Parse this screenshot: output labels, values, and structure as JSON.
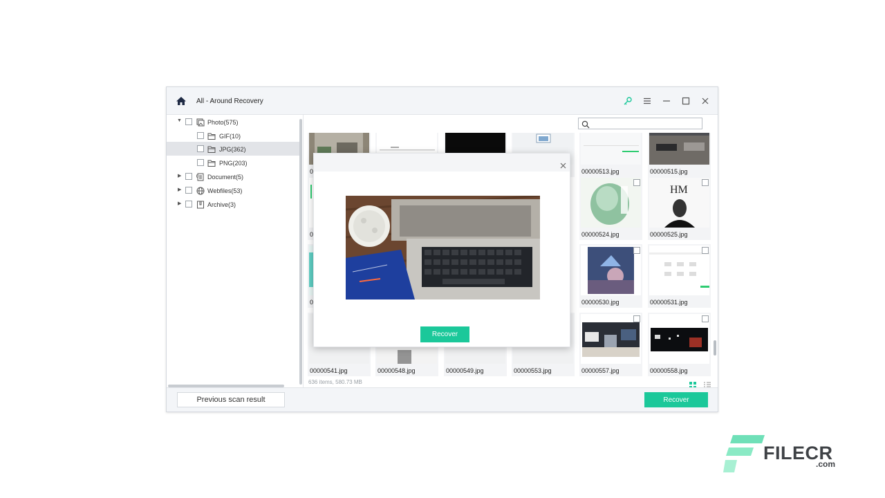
{
  "app": {
    "title": "All - Around Recovery",
    "accent_color": "#1bc89a"
  },
  "titlebar_icons": [
    "home-icon",
    "key-icon",
    "menu-icon",
    "minimize-icon",
    "maximize-icon",
    "close-icon"
  ],
  "sidebar": {
    "items": [
      {
        "label": "Photo(575)",
        "icon": "photo-icon",
        "expanded": true,
        "level": 0
      },
      {
        "label": "GIF(10)",
        "icon": "folder-icon",
        "level": 1
      },
      {
        "label": "JPG(362)",
        "icon": "folder-icon",
        "level": 1,
        "selected": true
      },
      {
        "label": "PNG(203)",
        "icon": "folder-icon",
        "level": 1
      },
      {
        "label": "Document(5)",
        "icon": "document-icon",
        "expanded": false,
        "level": 0
      },
      {
        "label": "Webfiles(53)",
        "icon": "globe-icon",
        "expanded": false,
        "level": 0
      },
      {
        "label": "Archive(3)",
        "icon": "archive-icon",
        "expanded": false,
        "level": 0
      }
    ]
  },
  "search": {
    "placeholder": ""
  },
  "grid": {
    "files": [
      "00000513.jpg",
      "00000515.jpg",
      "00000524.jpg",
      "00000525.jpg",
      "00000530.jpg",
      "00000531.jpg",
      "00000541.jpg",
      "00000548.jpg",
      "00000549.jpg",
      "00000553.jpg",
      "00000557.jpg",
      "00000558.jpg"
    ],
    "partial_label": "0"
  },
  "status": {
    "text": "636 items, 580.73 MB"
  },
  "footer": {
    "previous_label": "Previous scan result",
    "recover_label": "Recover"
  },
  "modal": {
    "recover_label": "Recover"
  },
  "watermark": {
    "name": "FILECR",
    "tld": ".com"
  }
}
